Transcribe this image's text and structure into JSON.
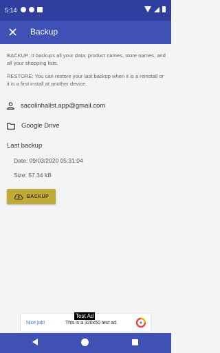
{
  "status_bar": {
    "time": "5:14"
  },
  "app_bar": {
    "title": "Backup"
  },
  "info": {
    "backup_text": "BACKUP: It backups all your data: product names, store names, and all your shopping lists.",
    "restore_text": "RESTORE: You can restore your last backup when it is a reinstall or it is a first install at another device."
  },
  "account": {
    "email": "sacolinhalist.app@gmail.com"
  },
  "storage": {
    "label": "Google Drive"
  },
  "last_backup": {
    "title": "Last backup",
    "date": "Date: 09/03/2020 05:31:04",
    "size": "Size: 57.34 kB"
  },
  "backup_button": {
    "label": "BACKUP"
  },
  "ad": {
    "badge": "Test Ad",
    "nice": "Nice job!",
    "text": "This is a 320x50 test ad."
  },
  "colors": {
    "primary": "#3f51b5",
    "primary_dark": "#303f9f",
    "accent": "#c0ab3a"
  }
}
